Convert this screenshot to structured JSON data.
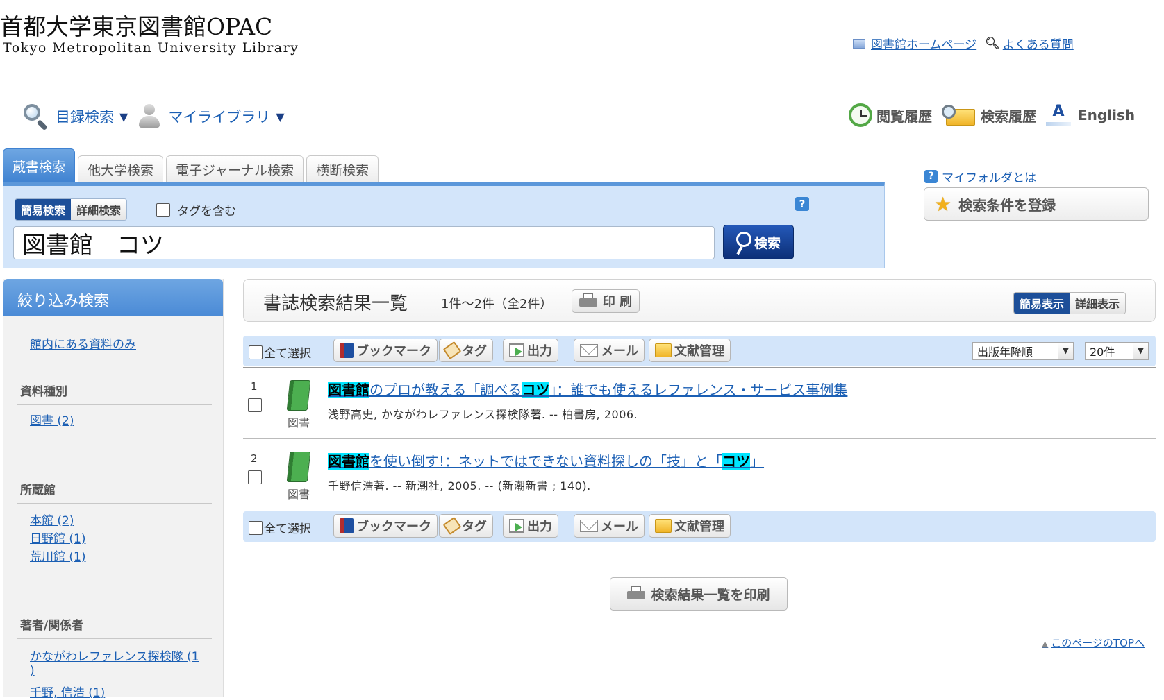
{
  "header": {
    "title": "首都大学東京図書館OPAC",
    "subtitle": "Tokyo Metropolitan University Library",
    "links": [
      "図書館ホームページ",
      "よくある質問"
    ]
  },
  "nav": {
    "catalog": "目録検索",
    "mylibrary": "マイライブラリ",
    "history_view": "閲覧履歴",
    "history_search": "検索履歴",
    "english": "English",
    "caret": "▼"
  },
  "search": {
    "tabs": [
      "蔵書検索",
      "他大学検索",
      "電子ジャーナル検索",
      "横断検索"
    ],
    "mode_simple": "簡易検索",
    "mode_advanced": "詳細検索",
    "include_tags": "タグを含む",
    "help": "?",
    "query": "図書館　コツ",
    "button": "検索"
  },
  "myfolder": {
    "link": "マイフォルダとは",
    "save_button": "検索条件を登録"
  },
  "sidebar": {
    "title": "絞り込み検索",
    "in_library": "館内にある資料のみ",
    "sections": [
      {
        "title": "資料種別",
        "items": [
          "図書 (2)"
        ]
      },
      {
        "title": "所蔵館",
        "items": [
          "本館 (2)",
          "日野館 (1)",
          "荒川館 (1)"
        ]
      },
      {
        "title": "著者/関係者",
        "items": [
          "かながわレファレンス探検隊 (1",
          ")",
          "千野, 信浩 (1)"
        ]
      }
    ]
  },
  "results": {
    "title": "書誌検索結果一覧",
    "count": "1件～2件（全2件）",
    "print": "印 刷",
    "view_simple": "簡易表示",
    "view_detail": "詳細表示",
    "toolbar": {
      "select_all": "全て選択",
      "bookmark": "ブックマーク",
      "tag": "タグ",
      "output": "出力",
      "mail": "メール",
      "reference": "文献管理"
    },
    "sort": "出版年降順",
    "per_page": "20件",
    "records": [
      {
        "no": "1",
        "type": "図書",
        "title_parts": [
          {
            "text": "図書館",
            "hl": true
          },
          {
            "text": "のプロが教える「調べる",
            "hl": false
          },
          {
            "text": "コツ",
            "hl": true
          },
          {
            "text": "」：誰でも使えるレファレンス・サービス事例集",
            "hl": false
          }
        ],
        "meta": "浅野高史, かながわレファレンス探検隊著. -- 柏書房, 2006."
      },
      {
        "no": "2",
        "type": "図書",
        "title_parts": [
          {
            "text": "図書館",
            "hl": true
          },
          {
            "text": "を使い倒す!：ネットではできない資料探しの「技」と「",
            "hl": false
          },
          {
            "text": "コツ",
            "hl": true
          },
          {
            "text": "」",
            "hl": false
          }
        ],
        "meta": "千野信浩著. -- 新潮社, 2005. -- (新潮新書 ; 140)."
      }
    ],
    "print_all": "検索結果一覧を印刷",
    "page_top": "このページのTOPへ"
  }
}
